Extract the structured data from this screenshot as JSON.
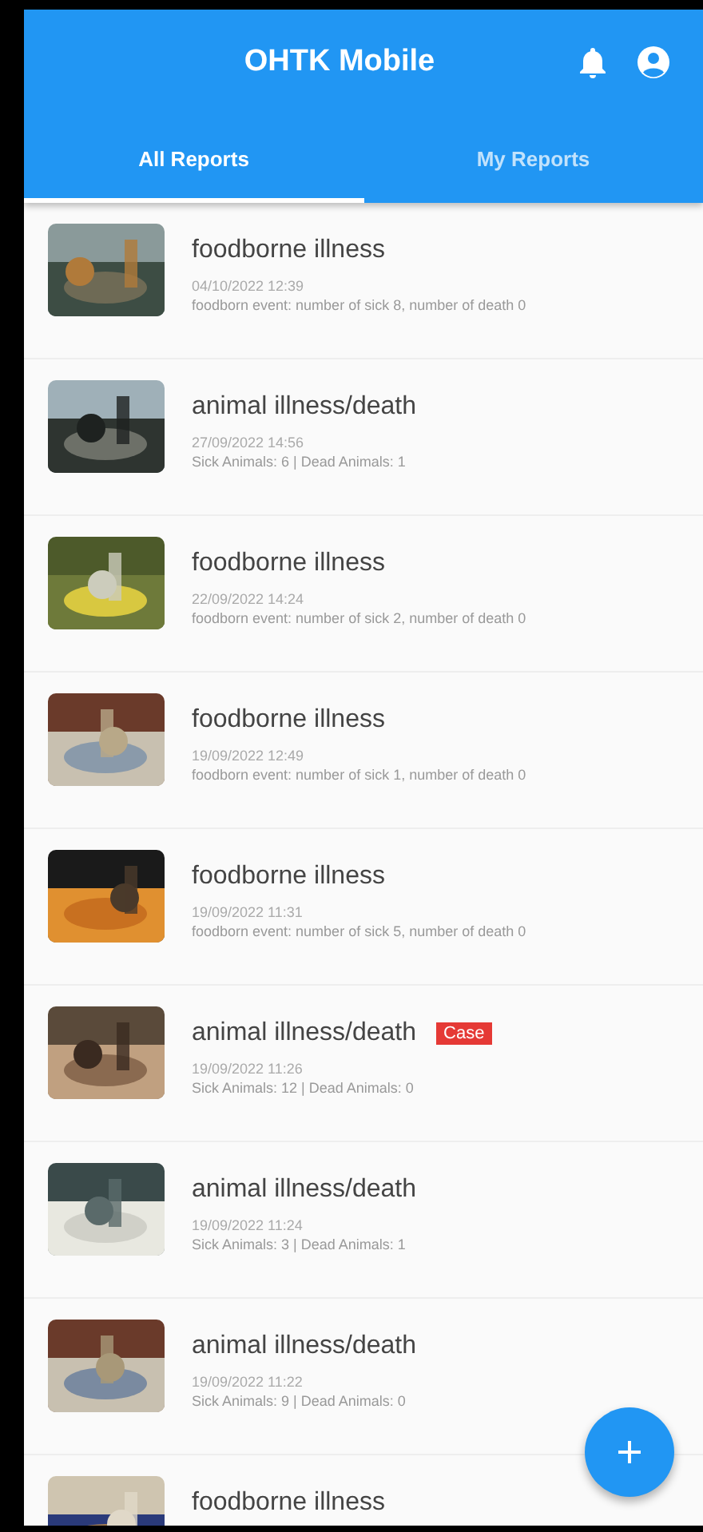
{
  "app_bar": {
    "title": "OHTK Mobile"
  },
  "tabs": [
    {
      "label": "All Reports",
      "selected": true
    },
    {
      "label": "My Reports",
      "selected": false
    }
  ],
  "reports": [
    {
      "title": "foodborne illness",
      "date": "04/10/2022 12:39",
      "summary": "foodborn event: number of sick 8, number of death 0"
    },
    {
      "title": "animal illness/death",
      "date": "27/09/2022 14:56",
      "summary": "Sick Animals: 6 | Dead Animals: 1"
    },
    {
      "title": "foodborne illness",
      "date": "22/09/2022 14:24",
      "summary": "foodborn event: number of sick 2, number of death 0"
    },
    {
      "title": "foodborne illness",
      "date": "19/09/2022 12:49",
      "summary": "foodborn event: number of sick 1, number of death 0"
    },
    {
      "title": "foodborne illness",
      "date": "19/09/2022 11:31",
      "summary": "foodborn event: number of sick 5, number of death 0"
    },
    {
      "title": "animal illness/death",
      "badge": "Case",
      "date": "19/09/2022 11:26",
      "summary": "Sick Animals: 12 | Dead Animals: 0"
    },
    {
      "title": "animal illness/death",
      "date": "19/09/2022 11:24",
      "summary": "Sick Animals: 3 | Dead Animals: 1"
    },
    {
      "title": "animal illness/death",
      "date": "19/09/2022 11:22",
      "summary": "Sick Animals: 9 | Dead Animals: 0"
    },
    {
      "title": "foodborne illness"
    }
  ]
}
